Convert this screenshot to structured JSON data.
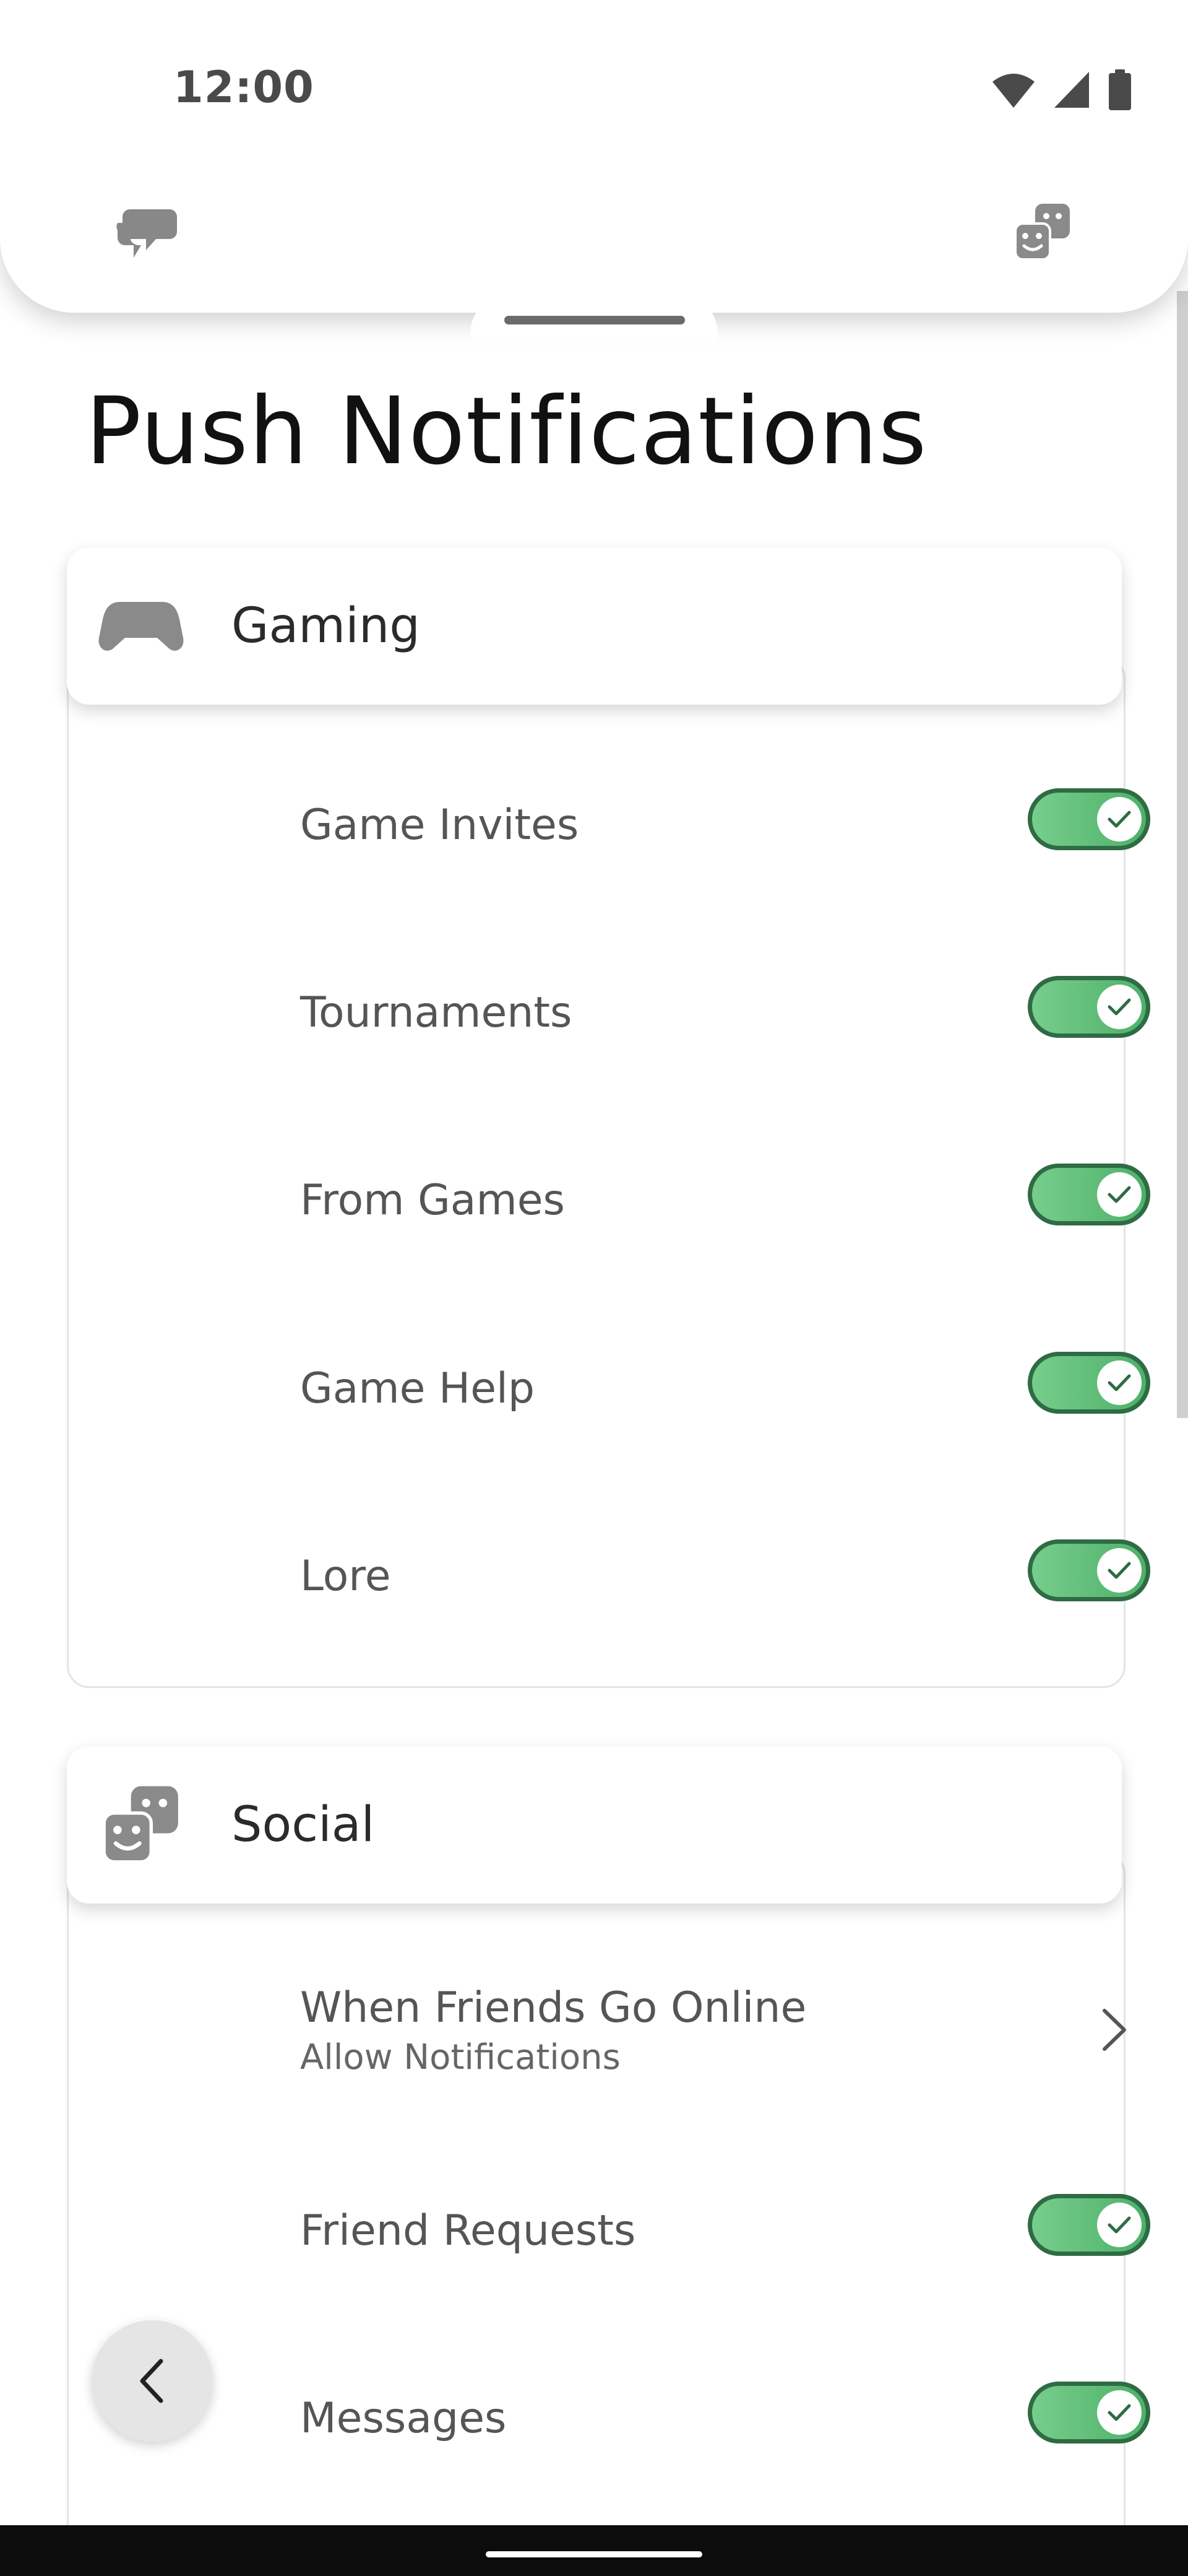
{
  "status_bar": {
    "time": "12:00"
  },
  "top_nav": {
    "left_icon": "chat-bubbles-icon",
    "right_icon": "social-masks-icon"
  },
  "page": {
    "title": "Push Notifications"
  },
  "groups": {
    "gaming": {
      "icon": "gamepad-icon",
      "title": "Gaming",
      "items": [
        {
          "label": "Game Invites",
          "enabled": true
        },
        {
          "label": "Tournaments",
          "enabled": true
        },
        {
          "label": "From Games",
          "enabled": true
        },
        {
          "label": "Game Help",
          "enabled": true
        },
        {
          "label": "Lore",
          "enabled": true
        }
      ]
    },
    "social": {
      "icon": "social-masks-icon",
      "title": "Social",
      "items": [
        {
          "label": "When Friends Go Online",
          "subtitle": "Allow Notifications",
          "type": "link"
        },
        {
          "label": "Friend Requests",
          "enabled": true
        },
        {
          "label": "Messages",
          "enabled": true
        }
      ]
    }
  },
  "back_button": {
    "icon": "chevron-left-icon"
  },
  "colors": {
    "toggle_on": "#4caf68",
    "toggle_border": "#2f6b45",
    "text_primary": "#111111",
    "text_secondary": "#555555"
  }
}
